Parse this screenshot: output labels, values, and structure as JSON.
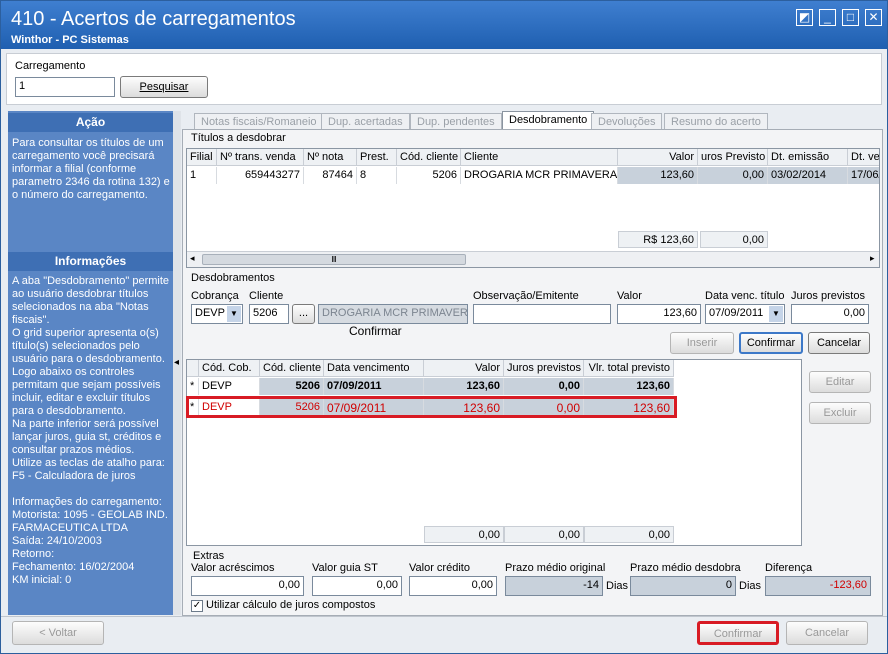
{
  "window": {
    "title": "410 - Acertos de carregamentos",
    "subtitle": "Winthor - PC Sistemas"
  },
  "top": {
    "carregamento_label": "Carregamento",
    "carregamento_value": "1",
    "pesquisar_label": "Pesquisar"
  },
  "sidebar": {
    "acao_title": "Ação",
    "acao_text": "Para consultar os títulos de um carregamento você precisará informar a filial (conforme parametro 2346 da rotina 132) e o número do carregamento.",
    "info_title": "Informações",
    "info_text": "A aba \"Desdobramento\" permite ao usuário desdobrar títulos selecionados na aba \"Notas fiscais\".\nO grid superior apresenta o(s) título(s) selecionados pelo usuário para o desdobramento. Logo abaixo os controles permitam que sejam possíveis incluir, editar e excluir títulos para o desdobramento.\nNa parte inferior será possível lançar juros, guia st, créditos e consultar prazos médios.\nUtilize as teclas de atalho para:\nF5 - Calculadora de juros\n\nInformações do carregamento:\nMotorista: 1095 - GEOLAB IND. FARMACEUTICA LTDA\nSaída: 24/10/2003\nRetorno:\nFechamento: 16/02/2004\nKM inicial: 0"
  },
  "tabs": [
    "Notas fiscais/Romaneio",
    "Dup. acertadas",
    "Dup. pendentes",
    "Desdobramento",
    "Devoluções",
    "Resumo do acerto"
  ],
  "titulos": {
    "group_label": "Títulos a desdobrar",
    "headers": [
      "Filial",
      "Nº trans. venda",
      "Nº nota",
      "Prest.",
      "Cód. cliente",
      "Cliente",
      "Valor",
      "uros Previsto",
      "Dt. emissão",
      "Dt. ve"
    ],
    "row": [
      "1",
      "659443277",
      "87464",
      "8",
      "5206",
      "DROGARIA MCR PRIMAVERA LT",
      "123,60",
      "0,00",
      "03/02/2014",
      "17/06/"
    ],
    "total_valor": "R$ 123,60",
    "total_juros": "0,00"
  },
  "desdobramentos": {
    "group_label": "Desdobramentos",
    "labels": {
      "cobranca": "Cobrança",
      "cliente": "Cliente",
      "obs": "Observação/Emitente",
      "valor": "Valor",
      "data_venc": "Data venc. título",
      "juros": "Juros previstos"
    },
    "values": {
      "cobranca": "DEVP",
      "cliente": "5206",
      "cliente_nome": "DROGARIA MCR PRIMAVERA L",
      "obs": "",
      "valor": "123,60",
      "data_venc": "07/09/2011",
      "juros": "0,00"
    },
    "browse_label": "...",
    "confirmar_overlay": "Confirmar",
    "buttons": {
      "inserir": "Inserir",
      "confirmar": "Confirmar",
      "cancelar": "Cancelar",
      "editar": "Editar",
      "excluir": "Excluir"
    },
    "headers": [
      "Cód. Cob.",
      "Cód. cliente",
      "Data vencimento",
      "Valor",
      "Juros previstos",
      "Vlr. total previsto"
    ],
    "rows": [
      {
        "marker": "*",
        "cells": [
          "DEVP",
          "5206",
          "07/09/2011",
          "123,60",
          "0,00",
          "123,60"
        ]
      },
      {
        "marker": "*",
        "cells": [
          "DEVP",
          "5206",
          "07/09/2011",
          "123,60",
          "0,00",
          "123,60"
        ]
      }
    ],
    "totals": [
      "0,00",
      "0,00",
      "0,00"
    ]
  },
  "extras": {
    "group_label": "Extras",
    "fields": [
      {
        "label": "Valor acréscimos",
        "value": "0,00"
      },
      {
        "label": "Valor guia ST",
        "value": "0,00"
      },
      {
        "label": "Valor crédito",
        "value": "0,00"
      },
      {
        "label": "Prazo médio original",
        "value": "-14",
        "unit": "Dias"
      },
      {
        "label": "Prazo médio desdobra",
        "value": "0",
        "unit": "Dias"
      },
      {
        "label": "Diferença",
        "value": "-123,60"
      }
    ],
    "checkbox_label": "Utilizar cálculo de juros compostos"
  },
  "footer": {
    "voltar": "< Voltar",
    "confirmar": "Confirmar",
    "cancelar": "Cancelar"
  },
  "colors": {
    "title_blue": "#2a6bc2",
    "highlight_red": "#d81b24"
  }
}
